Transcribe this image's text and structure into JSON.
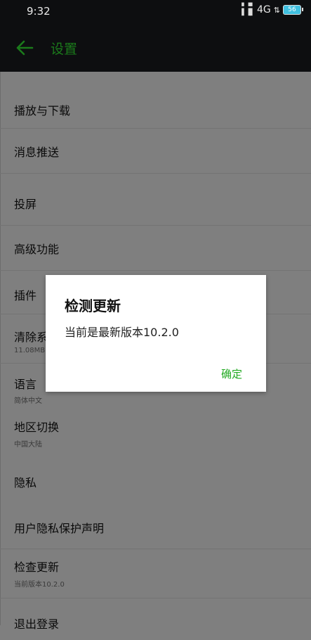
{
  "status": {
    "time": "9:32",
    "network": "4G",
    "battery": "56"
  },
  "appbar": {
    "title": "设置"
  },
  "settings": {
    "items": [
      {
        "label": "播放与下载"
      },
      {
        "label": "消息推送"
      },
      {
        "label": "投屏"
      },
      {
        "label": "高级功能"
      },
      {
        "label": "插件"
      },
      {
        "label": "清除系",
        "sub": "11.08MB"
      },
      {
        "label": "语言",
        "sub": "简体中文"
      },
      {
        "label": "地区切换",
        "sub": "中国大陆"
      },
      {
        "label": "隐私"
      },
      {
        "label": "用户隐私保护声明"
      },
      {
        "label": "检查更新",
        "sub": "当前版本10.2.0"
      },
      {
        "label": "退出登录"
      }
    ]
  },
  "dialog": {
    "title": "检测更新",
    "message": "当前是最新版本10.2.0",
    "ok_label": "确定"
  },
  "colors": {
    "accent": "#22aa22",
    "appbar": "#0d0e10",
    "overlay": "#7f7f7f"
  }
}
